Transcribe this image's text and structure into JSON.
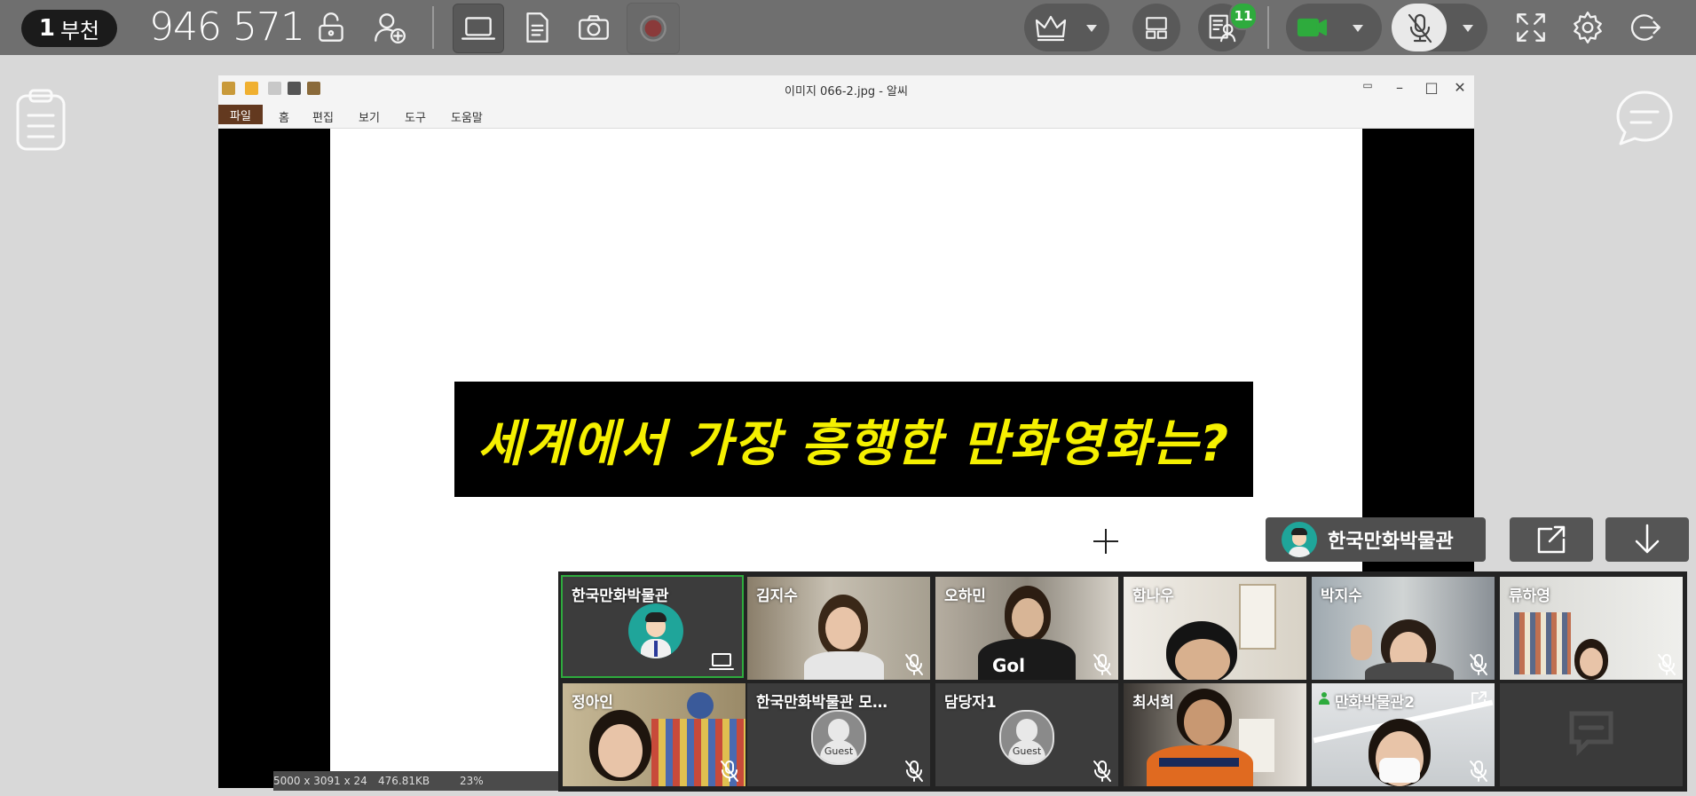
{
  "topbar": {
    "room_number": "1",
    "room_name": "부천",
    "room_code": "946 571",
    "participants_count": "11",
    "icons": [
      "unlock-icon",
      "add-user-icon",
      "screen-share-icon",
      "document-icon",
      "camera-icon",
      "record-icon",
      "crown-icon",
      "layout-icon",
      "participants-list-icon",
      "video-camera-icon",
      "mic-off-icon",
      "fullscreen-icon",
      "settings-icon",
      "exit-icon"
    ],
    "accent_green": "#2eab3d"
  },
  "viewer": {
    "title": "이미지 066-2.jpg - 알씨",
    "menu": [
      "파일",
      "홈",
      "편집",
      "보기",
      "도구",
      "도움말"
    ],
    "banner_text": "세계에서 가장 흥행한 만화영화는?",
    "banner_color": "#f5f000",
    "status": {
      "dimensions": "5000 x 3091 x 24",
      "size": "476.81KB",
      "zoom": "23%"
    }
  },
  "presenter": {
    "name": "한국만화박물관"
  },
  "participants": [
    {
      "name": "한국만화박물관",
      "type": "avatar",
      "muted": false,
      "active": true
    },
    {
      "name": "김지수",
      "type": "video",
      "muted": true
    },
    {
      "name": "오하민",
      "type": "video",
      "muted": true
    },
    {
      "name": "함나우",
      "type": "video",
      "muted": false
    },
    {
      "name": "박지수",
      "type": "video",
      "muted": true
    },
    {
      "name": "류하영",
      "type": "video",
      "muted": true
    },
    {
      "name": "정아인",
      "type": "video",
      "muted": true
    },
    {
      "name": "한국만화박물관 모…",
      "type": "guest",
      "muted": true
    },
    {
      "name": "담당자1",
      "type": "guest",
      "muted": true
    },
    {
      "name": "최서희",
      "type": "video",
      "muted": false
    },
    {
      "name": "만화박물관2",
      "type": "video",
      "muted": true
    },
    {
      "name": "",
      "type": "chat-placeholder",
      "muted": false
    }
  ],
  "guest_label": "Guest"
}
